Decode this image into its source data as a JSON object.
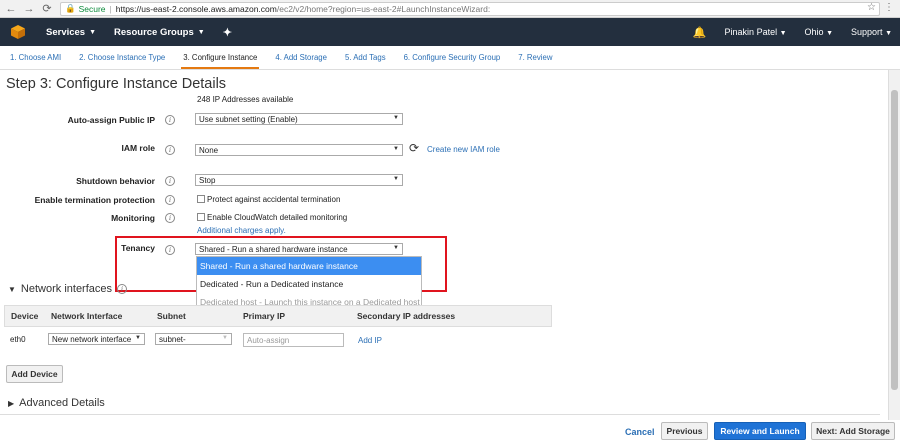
{
  "browser": {
    "secure_label": "Secure",
    "url_host": "https://us-east-2.console.aws.amazon.com",
    "url_rest": "/ec2/v2/home?region=us-east-2#LaunchInstanceWizard:"
  },
  "topnav": {
    "services": "Services",
    "resource_groups": "Resource Groups",
    "user": "Pinakin Patel",
    "region": "Ohio",
    "support": "Support"
  },
  "steps": [
    "1. Choose AMI",
    "2. Choose Instance Type",
    "3. Configure Instance",
    "4. Add Storage",
    "5. Add Tags",
    "6. Configure Security Group",
    "7. Review"
  ],
  "page": {
    "title": "Step 3: Configure Instance Details",
    "ip_available": "248 IP Addresses available"
  },
  "form": {
    "auto_assign_label": "Auto-assign Public IP",
    "auto_assign_value": "Use subnet setting (Enable)",
    "iam_label": "IAM role",
    "iam_value": "None",
    "create_iam": "Create new IAM role",
    "shutdown_label": "Shutdown behavior",
    "shutdown_value": "Stop",
    "termination_label": "Enable termination protection",
    "termination_check": "Protect against accidental termination",
    "monitoring_label": "Monitoring",
    "monitoring_check": "Enable CloudWatch detailed monitoring",
    "additional_charges": "Additional charges apply.",
    "tenancy_label": "Tenancy",
    "tenancy_value": "Shared - Run a shared hardware instance",
    "tenancy_options": [
      "Shared - Run a shared hardware instance",
      "Dedicated - Run a Dedicated instance",
      "Dedicated host - Launch this instance on a Dedicated host"
    ]
  },
  "network": {
    "section_title": "Network interfaces",
    "headers": [
      "Device",
      "Network Interface",
      "Subnet",
      "Primary IP",
      "Secondary IP addresses"
    ],
    "row": {
      "device": "eth0",
      "interface": "New network interface",
      "subnet": "subnet-",
      "primary_ip_placeholder": "Auto-assign",
      "add_ip": "Add IP"
    },
    "add_device": "Add Device"
  },
  "advanced": {
    "section_title": "Advanced Details"
  },
  "footer": {
    "cancel": "Cancel",
    "previous": "Previous",
    "review_launch": "Review and Launch",
    "next": "Next: Add Storage"
  },
  "colors": {
    "aws_nav": "#232f3e",
    "link": "#2b6fb5",
    "accent_orange": "#e47911",
    "primary_blue": "#1f73d6",
    "highlight_red": "#e0141e"
  }
}
